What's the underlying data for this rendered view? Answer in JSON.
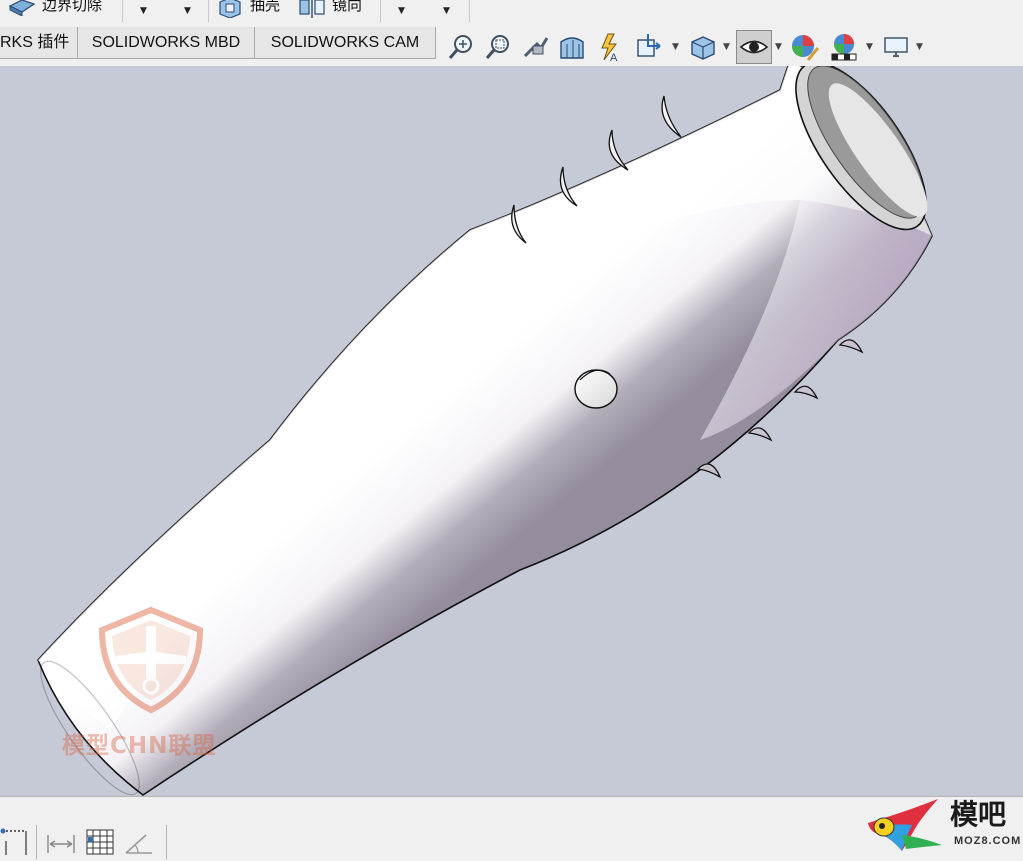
{
  "toolbar": {
    "row1": {
      "boundary_cut_label": "边界切除",
      "shell_label": "抽壳",
      "mirror_label": "镜向"
    },
    "tabs": [
      {
        "label": "RKS 插件"
      },
      {
        "label": "SOLIDWORKS MBD"
      },
      {
        "label": "SOLIDWORKS CAM"
      }
    ]
  },
  "watermarks": {
    "center_text": "模型CHN联盟",
    "logo_text": "模吧",
    "logo_url": "MOZ8.COM"
  },
  "colors": {
    "toolbar_bg": "#f0f0f0",
    "viewport_bg": "#c6cad6",
    "part_highlight": "#ffffff",
    "part_shadow": "#8d8797",
    "watermark_orange": "#d9603a"
  }
}
